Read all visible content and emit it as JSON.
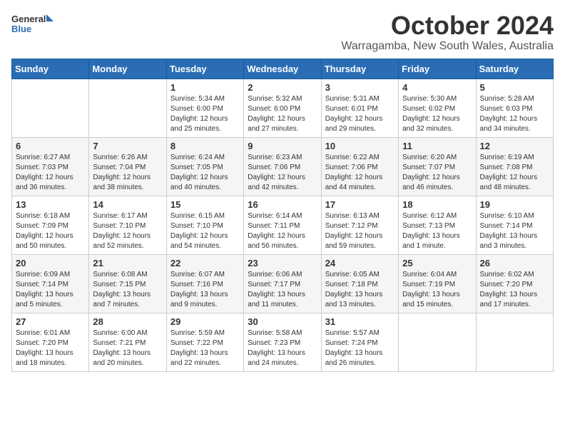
{
  "logo": {
    "general": "General",
    "blue": "Blue"
  },
  "title": {
    "month": "October 2024",
    "location": "Warragamba, New South Wales, Australia"
  },
  "weekdays": [
    "Sunday",
    "Monday",
    "Tuesday",
    "Wednesday",
    "Thursday",
    "Friday",
    "Saturday"
  ],
  "weeks": [
    [
      {
        "day": "",
        "info": ""
      },
      {
        "day": "",
        "info": ""
      },
      {
        "day": "1",
        "info": "Sunrise: 5:34 AM\nSunset: 6:00 PM\nDaylight: 12 hours\nand 25 minutes."
      },
      {
        "day": "2",
        "info": "Sunrise: 5:32 AM\nSunset: 6:00 PM\nDaylight: 12 hours\nand 27 minutes."
      },
      {
        "day": "3",
        "info": "Sunrise: 5:31 AM\nSunset: 6:01 PM\nDaylight: 12 hours\nand 29 minutes."
      },
      {
        "day": "4",
        "info": "Sunrise: 5:30 AM\nSunset: 6:02 PM\nDaylight: 12 hours\nand 32 minutes."
      },
      {
        "day": "5",
        "info": "Sunrise: 5:28 AM\nSunset: 6:03 PM\nDaylight: 12 hours\nand 34 minutes."
      }
    ],
    [
      {
        "day": "6",
        "info": "Sunrise: 6:27 AM\nSunset: 7:03 PM\nDaylight: 12 hours\nand 36 minutes."
      },
      {
        "day": "7",
        "info": "Sunrise: 6:26 AM\nSunset: 7:04 PM\nDaylight: 12 hours\nand 38 minutes."
      },
      {
        "day": "8",
        "info": "Sunrise: 6:24 AM\nSunset: 7:05 PM\nDaylight: 12 hours\nand 40 minutes."
      },
      {
        "day": "9",
        "info": "Sunrise: 6:23 AM\nSunset: 7:06 PM\nDaylight: 12 hours\nand 42 minutes."
      },
      {
        "day": "10",
        "info": "Sunrise: 6:22 AM\nSunset: 7:06 PM\nDaylight: 12 hours\nand 44 minutes."
      },
      {
        "day": "11",
        "info": "Sunrise: 6:20 AM\nSunset: 7:07 PM\nDaylight: 12 hours\nand 46 minutes."
      },
      {
        "day": "12",
        "info": "Sunrise: 6:19 AM\nSunset: 7:08 PM\nDaylight: 12 hours\nand 48 minutes."
      }
    ],
    [
      {
        "day": "13",
        "info": "Sunrise: 6:18 AM\nSunset: 7:09 PM\nDaylight: 12 hours\nand 50 minutes."
      },
      {
        "day": "14",
        "info": "Sunrise: 6:17 AM\nSunset: 7:10 PM\nDaylight: 12 hours\nand 52 minutes."
      },
      {
        "day": "15",
        "info": "Sunrise: 6:15 AM\nSunset: 7:10 PM\nDaylight: 12 hours\nand 54 minutes."
      },
      {
        "day": "16",
        "info": "Sunrise: 6:14 AM\nSunset: 7:11 PM\nDaylight: 12 hours\nand 56 minutes."
      },
      {
        "day": "17",
        "info": "Sunrise: 6:13 AM\nSunset: 7:12 PM\nDaylight: 12 hours\nand 59 minutes."
      },
      {
        "day": "18",
        "info": "Sunrise: 6:12 AM\nSunset: 7:13 PM\nDaylight: 13 hours\nand 1 minute."
      },
      {
        "day": "19",
        "info": "Sunrise: 6:10 AM\nSunset: 7:14 PM\nDaylight: 13 hours\nand 3 minutes."
      }
    ],
    [
      {
        "day": "20",
        "info": "Sunrise: 6:09 AM\nSunset: 7:14 PM\nDaylight: 13 hours\nand 5 minutes."
      },
      {
        "day": "21",
        "info": "Sunrise: 6:08 AM\nSunset: 7:15 PM\nDaylight: 13 hours\nand 7 minutes."
      },
      {
        "day": "22",
        "info": "Sunrise: 6:07 AM\nSunset: 7:16 PM\nDaylight: 13 hours\nand 9 minutes."
      },
      {
        "day": "23",
        "info": "Sunrise: 6:06 AM\nSunset: 7:17 PM\nDaylight: 13 hours\nand 11 minutes."
      },
      {
        "day": "24",
        "info": "Sunrise: 6:05 AM\nSunset: 7:18 PM\nDaylight: 13 hours\nand 13 minutes."
      },
      {
        "day": "25",
        "info": "Sunrise: 6:04 AM\nSunset: 7:19 PM\nDaylight: 13 hours\nand 15 minutes."
      },
      {
        "day": "26",
        "info": "Sunrise: 6:02 AM\nSunset: 7:20 PM\nDaylight: 13 hours\nand 17 minutes."
      }
    ],
    [
      {
        "day": "27",
        "info": "Sunrise: 6:01 AM\nSunset: 7:20 PM\nDaylight: 13 hours\nand 18 minutes."
      },
      {
        "day": "28",
        "info": "Sunrise: 6:00 AM\nSunset: 7:21 PM\nDaylight: 13 hours\nand 20 minutes."
      },
      {
        "day": "29",
        "info": "Sunrise: 5:59 AM\nSunset: 7:22 PM\nDaylight: 13 hours\nand 22 minutes."
      },
      {
        "day": "30",
        "info": "Sunrise: 5:58 AM\nSunset: 7:23 PM\nDaylight: 13 hours\nand 24 minutes."
      },
      {
        "day": "31",
        "info": "Sunrise: 5:57 AM\nSunset: 7:24 PM\nDaylight: 13 hours\nand 26 minutes."
      },
      {
        "day": "",
        "info": ""
      },
      {
        "day": "",
        "info": ""
      }
    ]
  ]
}
